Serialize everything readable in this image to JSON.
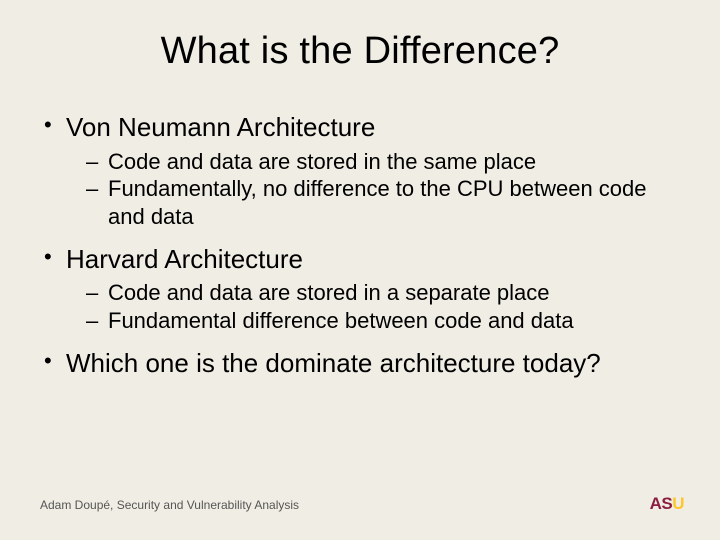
{
  "title": "What is the Difference?",
  "bullets": {
    "b1": {
      "label": "Von Neumann Architecture",
      "sub": {
        "s1": "Code and data are stored in the same place",
        "s2": "Fundamentally, no difference to the CPU between code and data"
      }
    },
    "b2": {
      "label": "Harvard Architecture",
      "sub": {
        "s1": "Code and data are stored in a separate place",
        "s2": "Fundamental difference between code and data"
      }
    },
    "b3": {
      "label": "Which one is the dominate architecture today?"
    }
  },
  "footer": "Adam Doupé, Security and Vulnerability Analysis",
  "logo": {
    "a": "A",
    "s": "S",
    "u": "U"
  }
}
